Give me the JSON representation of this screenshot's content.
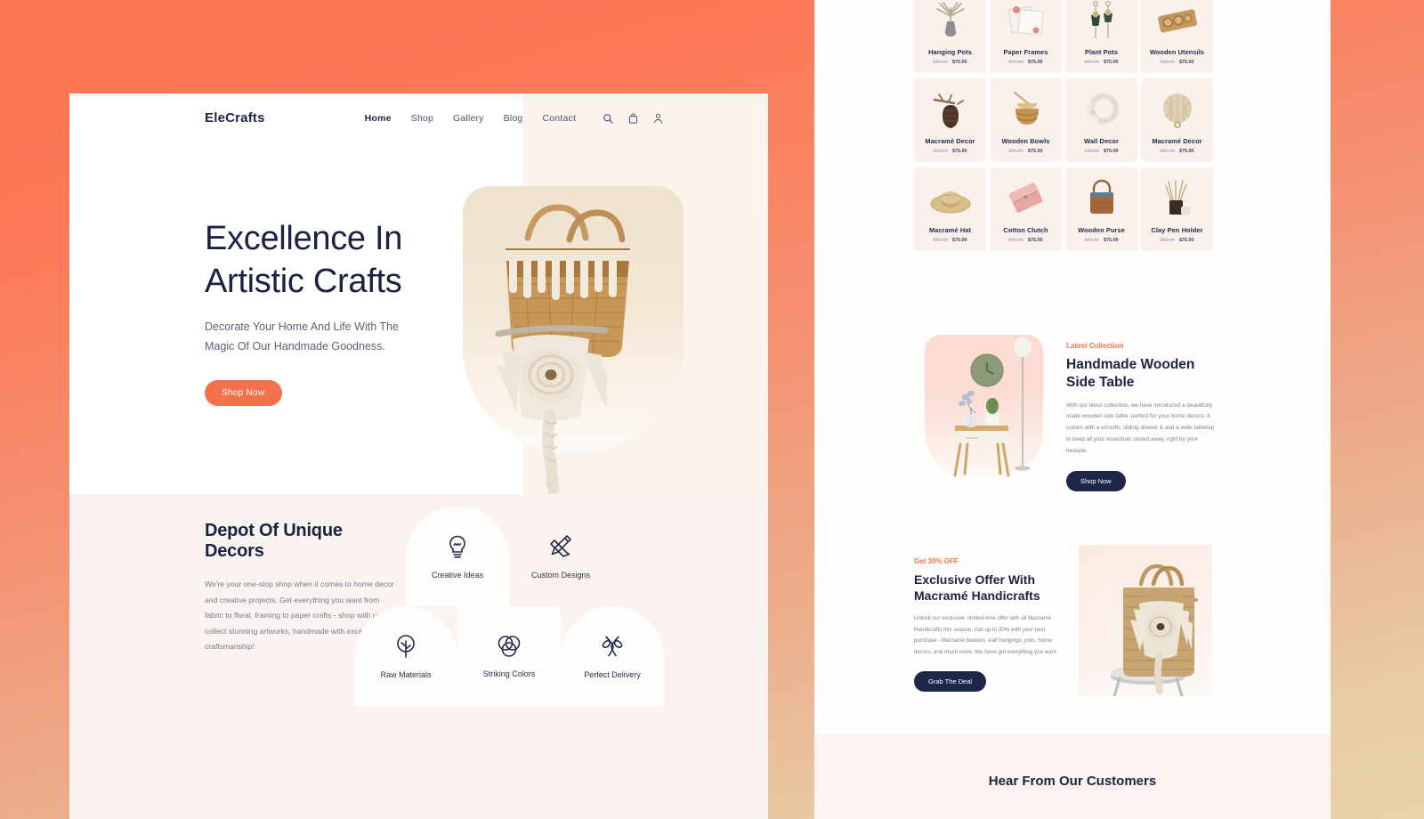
{
  "theme": {
    "bg_gradient_start": "#FF7452",
    "bg_gradient_end": "#E9D3AC",
    "accent_coral": "#F4714E",
    "ink_navy": "#1B2142",
    "panel_cream": "#FBF3F0"
  },
  "site": {
    "brand": "EleCrafts",
    "nav": [
      {
        "label": "Home",
        "active": true
      },
      {
        "label": "Shop",
        "active": false
      },
      {
        "label": "Gallery",
        "active": false
      },
      {
        "label": "Blog",
        "active": false
      },
      {
        "label": "Contact",
        "active": false
      }
    ],
    "nav_icons": [
      "search-icon",
      "bag-icon",
      "user-icon"
    ]
  },
  "hero": {
    "title_line1": "Excellence In",
    "title_line2": "Artistic Crafts",
    "subtitle_line1": "Decorate Your Home And Life With The",
    "subtitle_line2": "Magic Of Our Handmade Goodness.",
    "cta": "Shop Now",
    "image_alt": "macrame-basket"
  },
  "features": {
    "title": "Depot Of Unique Decors",
    "text": "We're your one-stop shop when it comes to home decor and creative projects. Get everything you want from fabric to floral, framing to paper crafts - shop with us and collect stunning artworks, handmade with excellent craftsmanship!",
    "cards": [
      {
        "label": "Creative Ideas",
        "icon": "lightbulb-icon"
      },
      {
        "label": "Custom Designs",
        "icon": "pencil-ruler-icon"
      },
      {
        "label": "Raw Materials",
        "icon": "tree-icon"
      },
      {
        "label": "Striking Colors",
        "icon": "color-circles-icon"
      },
      {
        "label": "Perfect Delivery",
        "icon": "scissors-icon"
      }
    ]
  },
  "products": [
    {
      "name": "Hanging Pots",
      "old_price": "$80.00",
      "new_price": "$75.00",
      "thumb": "fan-plant-vase"
    },
    {
      "name": "Paper Frames",
      "old_price": "$80.00",
      "new_price": "$75.00",
      "thumb": "photo-frames"
    },
    {
      "name": "Plant Pots",
      "old_price": "$80.00",
      "new_price": "$75.00",
      "thumb": "hanging-planters"
    },
    {
      "name": "Wooden Utensils",
      "old_price": "$80.00",
      "new_price": "$75.00",
      "thumb": "wooden-tray-bowls"
    },
    {
      "name": "Macramé Decor",
      "old_price": "$80.00",
      "new_price": "$75.00",
      "thumb": "pinecone-branch"
    },
    {
      "name": "Wooden Bowls",
      "old_price": "$80.00",
      "new_price": "$75.00",
      "thumb": "wooden-bowl-stack"
    },
    {
      "name": "Wall Decor",
      "old_price": "$80.00",
      "new_price": "$75.00",
      "thumb": "wreath-ring"
    },
    {
      "name": "Macramé Decor",
      "old_price": "$80.00",
      "new_price": "$75.00",
      "thumb": "woven-fan"
    },
    {
      "name": "Macramé Hat",
      "old_price": "$80.00",
      "new_price": "$75.00",
      "thumb": "straw-hat"
    },
    {
      "name": "Cotton Clutch",
      "old_price": "$80.00",
      "new_price": "$75.00",
      "thumb": "pink-clutch"
    },
    {
      "name": "Wooden Purse",
      "old_price": "$80.00",
      "new_price": "$75.00",
      "thumb": "woven-purse"
    },
    {
      "name": "Clay Pen Holder",
      "old_price": "$80.00",
      "new_price": "$75.00",
      "thumb": "reed-diffuser"
    }
  ],
  "latest": {
    "eyebrow": "Latest Collection",
    "title_line1": "Handmade Wooden",
    "title_line2": "Side Table",
    "text": "With our latest collection, we have introduced a beautifully made wooden side table, perfect for your home decors. It comes with a smooth, sliding drawer & and a wide tabletop to keep all your essentials stored away, right by your bedside.",
    "cta": "Shop Now",
    "image_alt": "wooden-side-table-scene"
  },
  "offer": {
    "eyebrow": "Get 30% OFF",
    "title_line1": "Exclusive Offer With",
    "title_line2": "Macramé Handicrafts",
    "text": "Unlock our exclusive, limited-time offer with all Macramé Handicrafts this season. Get up to 30% with your next purchase - Macramé baskets, wall hangings, pots, home decors, and much more. We have got everything you want",
    "cta": "Grab The Deal",
    "image_alt": "macrame-basket-on-stool"
  },
  "testimonials": {
    "heading": "Hear From Our Customers"
  }
}
